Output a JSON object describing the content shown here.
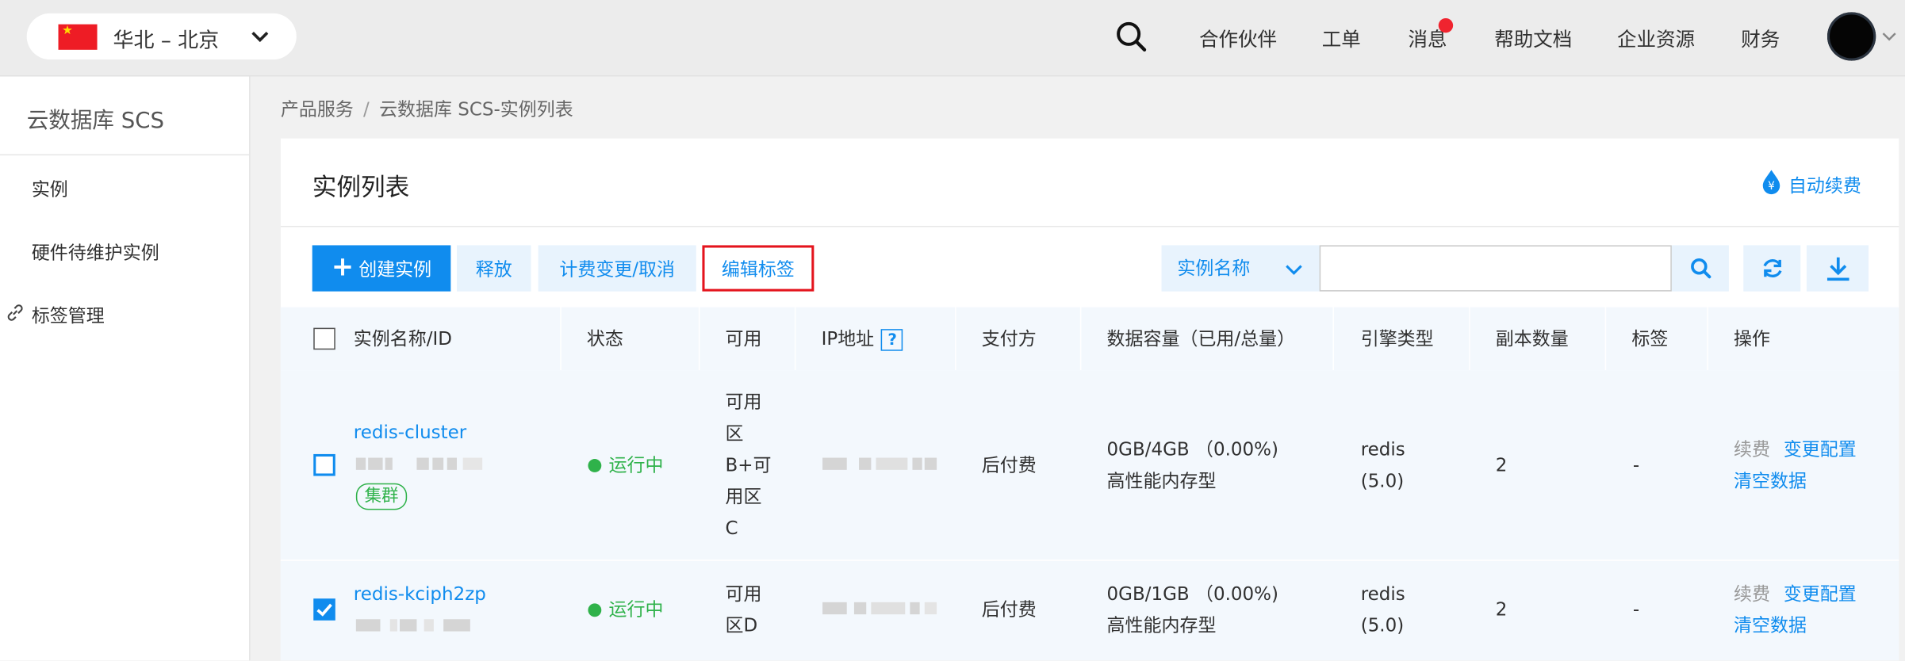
{
  "topbar": {
    "region_label": "华北 – 北京",
    "nav": [
      "合作伙伴",
      "工单",
      "消息",
      "帮助文档",
      "企业资源",
      "财务"
    ]
  },
  "sidebar": {
    "title": "云数据库 SCS",
    "items": [
      {
        "label": "实例"
      },
      {
        "label": "硬件待维护实例"
      },
      {
        "label": "标签管理"
      }
    ]
  },
  "breadcrumb": [
    "产品服务",
    "云数据库 SCS-实例列表"
  ],
  "panel": {
    "title": "实例列表",
    "auto_renew": "自动续费"
  },
  "toolbar": {
    "create": "创建实例",
    "release": "释放",
    "billing_change": "计费变更/取消",
    "edit_tags": "编辑标签",
    "filter_field": "实例名称",
    "search_value": ""
  },
  "table": {
    "headers": [
      "实例名称/ID",
      "状态",
      "可用",
      "IP地址",
      "支付方",
      "数据容量（已用/总量）",
      "引擎类型",
      "副本数量",
      "标签",
      "操作"
    ],
    "ip_help": "?",
    "rows": [
      {
        "name": "redis-cluster",
        "tag": "集群",
        "status": "运行中",
        "zone_lines": [
          "可用",
          "区",
          "B+可",
          "用区",
          "C"
        ],
        "payer": "后付费",
        "capacity": "0GB/4GB （0.00%)",
        "capacity_type": "高性能内存型",
        "engine": "redis",
        "engine_ver": "(5.0)",
        "replicas": "2",
        "tags": "-",
        "op_renew": "续费",
        "op_resize": "变更配置",
        "op_flush": "清空数据",
        "checked": false
      },
      {
        "name": "redis-kciph2zp",
        "status": "运行中",
        "zone_lines": [
          "可用",
          "区D"
        ],
        "payer": "后付费",
        "capacity": "0GB/1GB （0.00%)",
        "capacity_type": "高性能内存型",
        "engine": "redis",
        "engine_ver": "(5.0)",
        "replicas": "2",
        "tags": "-",
        "op_renew": "续费",
        "op_resize": "变更配置",
        "op_flush": "清空数据",
        "checked": true
      }
    ]
  },
  "colors": {
    "accent": "#108cee",
    "running": "#2fb24a",
    "highlight_border": "#e4141d",
    "notification": "#f0242f"
  }
}
